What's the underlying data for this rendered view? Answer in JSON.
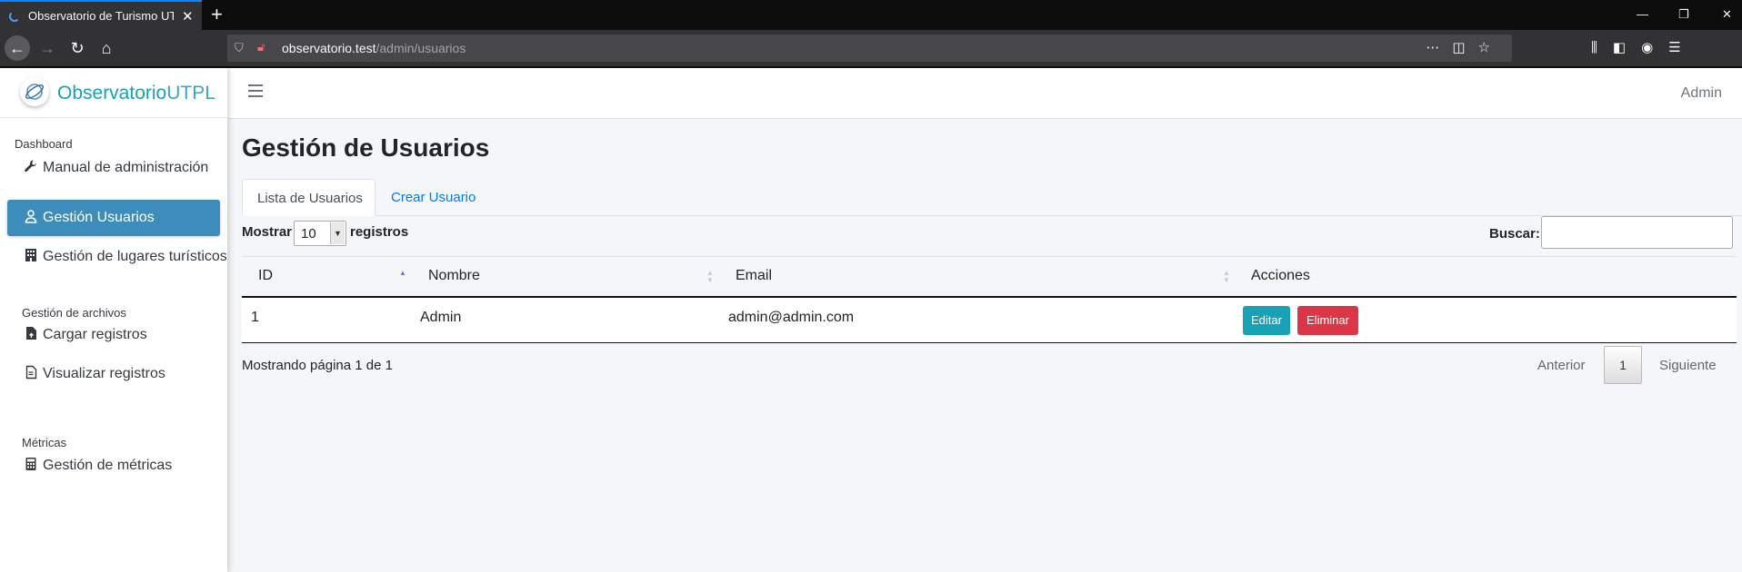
{
  "browser": {
    "tab_title": "Observatorio de Turismo UTPL",
    "url_host": "observatorio.test",
    "url_path": "/admin/usuarios"
  },
  "brand": {
    "name_bold": "Observatorio",
    "name_light": "UTPL",
    "accent_color": "#17a2b8"
  },
  "sidebar": {
    "sections": [
      {
        "header": "Dashboard",
        "items": [
          {
            "label": "Manual de administración",
            "icon": "wrench-icon"
          },
          {
            "label": "Gestión Usuarios",
            "icon": "user-icon",
            "active": true
          },
          {
            "label": "Gestión de lugares turísticos",
            "icon": "building-icon"
          }
        ]
      },
      {
        "header": "Gestión de archivos",
        "items": [
          {
            "label": "Cargar registros",
            "icon": "file-upload-icon"
          },
          {
            "label": "Visualizar registros",
            "icon": "file-view-icon"
          }
        ]
      },
      {
        "header": "Métricas",
        "items": [
          {
            "label": "Gestión de métricas",
            "icon": "calculator-icon"
          }
        ]
      }
    ]
  },
  "topnav": {
    "user": "Admin"
  },
  "page": {
    "title": "Gestión de Usuarios",
    "tabs": [
      {
        "label": "Lista de Usuarios",
        "active": true
      },
      {
        "label": "Crear Usuario",
        "active": false
      }
    ]
  },
  "datatable": {
    "length_prefix": "Mostrar",
    "length_value": "10",
    "length_suffix": "registros",
    "search_label": "Buscar:",
    "search_value": "",
    "columns": [
      "ID",
      "Nombre",
      "Email",
      "Acciones"
    ],
    "rows": [
      {
        "id": "1",
        "nombre": "Admin",
        "email": "admin@admin.com",
        "edit_label": "Editar",
        "delete_label": "Eliminar"
      }
    ],
    "info": "Mostrando página 1 de 1",
    "pagination": {
      "prev": "Anterior",
      "current": "1",
      "next": "Siguiente"
    }
  }
}
